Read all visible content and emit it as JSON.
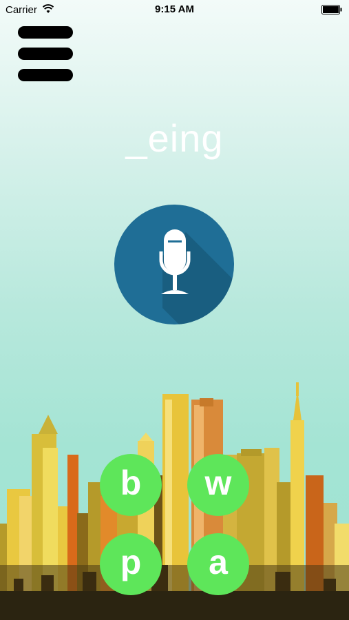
{
  "status_bar": {
    "carrier": "Carrier",
    "time": "9:15 AM",
    "wifi_icon": "wifi-icon",
    "battery_icon": "battery-icon"
  },
  "menu": {
    "icon": "hamburger-menu-icon"
  },
  "word": {
    "text": "_eing"
  },
  "mic": {
    "icon": "microphone-icon",
    "color": "#1f6e96"
  },
  "letters": [
    "b",
    "w",
    "p",
    "a"
  ],
  "colors": {
    "letter_button": "#5ee65a",
    "background_top": "#f3fbf9",
    "background_bottom": "#9ee2d2",
    "skyline_ground": "#2b2411"
  }
}
